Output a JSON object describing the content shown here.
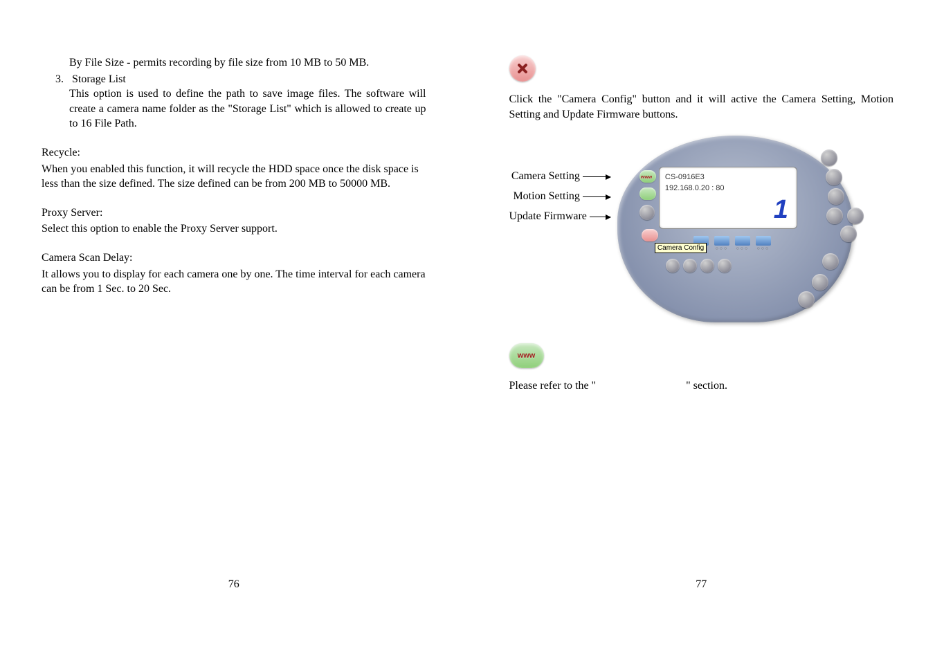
{
  "left_page": {
    "file_size_text": "By File Size - permits recording by file size from 10 MB to 50 MB.",
    "storage_list_num": "3.",
    "storage_list_label": "Storage List",
    "storage_list_body": "This option is used to define the path to save image files. The software will create a camera name folder as the \"Storage List\" which is allowed to create up to 16 File Path.",
    "recycle_title": "Recycle:",
    "recycle_body": "When you enabled this function, it will recycle the HDD space once the disk space is less than the size defined.  The size defined can be from 200 MB to 50000 MB.",
    "proxy_title": "Proxy Server:",
    "proxy_body": "Select this option to enable the Proxy Server support.",
    "scan_title": "Camera Scan Delay:",
    "scan_body": "It allows you to display for each camera one by one.  The time interval for each camera can be from 1 Sec. to 20 Sec.",
    "page_number": "76"
  },
  "right_page": {
    "camera_config_text": "Click the \"Camera Config\" button and it will active the Camera Setting, Motion Setting and Update Firmware buttons.",
    "label_camera_setting": "Camera Setting",
    "label_motion_setting": "Motion Setting",
    "label_update_firmware": "Update Firmware",
    "screen_line1": "CS-0916E3",
    "screen_line2": "192.168.0.20 : 80",
    "big_one": "1",
    "tooltip": "Camera Config",
    "www_label": "www",
    "refer_prefix": "Please refer to the \"",
    "refer_suffix": "\" section.",
    "page_number": "77"
  }
}
